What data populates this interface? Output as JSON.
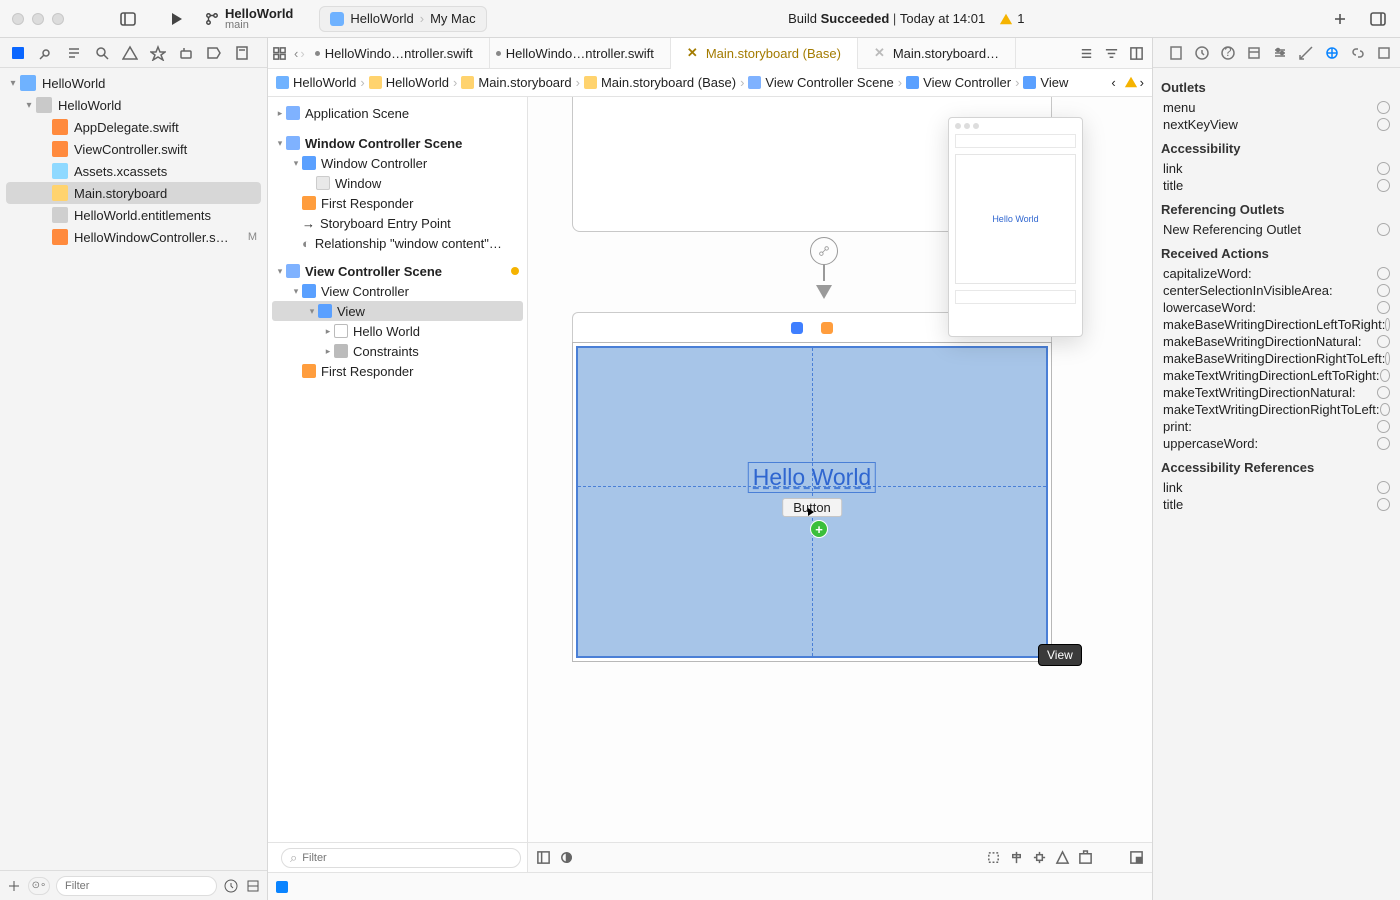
{
  "titlebar": {
    "project_name": "HelloWorld",
    "branch": "main",
    "scheme_app": "HelloWorld",
    "scheme_dest": "My Mac",
    "status_prefix": "Build ",
    "status_result": "Succeeded",
    "status_time": "Today at 14:01",
    "warning_count": "1"
  },
  "nav": {
    "root": "HelloWorld",
    "group": "HelloWorld",
    "files": [
      "AppDelegate.swift",
      "ViewController.swift",
      "Assets.xcassets",
      "Main.storyboard",
      "HelloWorld.entitlements",
      "HelloWindowController.s…"
    ],
    "modified_badge": "M",
    "filter_placeholder": "Filter"
  },
  "tabs": {
    "t1": "HelloWindo…ntroller.swift",
    "t2": "HelloWindo…ntroller.swift",
    "t3": "Main.storyboard (Base)",
    "t4": "Main.storyboard…"
  },
  "jumpbar": {
    "c1": "HelloWorld",
    "c2": "HelloWorld",
    "c3": "Main.storyboard",
    "c4": "Main.storyboard (Base)",
    "c5": "View Controller Scene",
    "c6": "View Controller",
    "c7": "View"
  },
  "outline": {
    "app_scene": "Application Scene",
    "wc_scene": "Window Controller Scene",
    "wc": "Window Controller",
    "window": "Window",
    "first_responder": "First Responder",
    "entry": "Storyboard Entry Point",
    "rel": "Relationship \"window content\"…",
    "vc_scene": "View Controller Scene",
    "vc": "View Controller",
    "view": "View",
    "hello": "Hello World",
    "constraints": "Constraints",
    "filter_placeholder": "Filter"
  },
  "canvas": {
    "hello_label": "Hello World",
    "button_label": "Button",
    "view_badge": "View",
    "lib_label": "Hello World"
  },
  "inspector": {
    "h_outlets": "Outlets",
    "menu": "menu",
    "nextKeyView": "nextKeyView",
    "h_access": "Accessibility",
    "link": "link",
    "title": "title",
    "h_ref": "Referencing Outlets",
    "newref": "New Referencing Outlet",
    "h_recv": "Received Actions",
    "actions": [
      "capitalizeWord:",
      "centerSelectionInVisibleArea:",
      "lowercaseWord:",
      "makeBaseWritingDirectionLeftToRight:",
      "makeBaseWritingDirectionNatural:",
      "makeBaseWritingDirectionRightToLeft:",
      "makeTextWritingDirectionLeftToRight:",
      "makeTextWritingDirectionNatural:",
      "makeTextWritingDirectionRightToLeft:",
      "print:",
      "uppercaseWord:"
    ],
    "h_accref": "Accessibility References",
    "link2": "link",
    "title2": "title"
  },
  "bottom": {
    "dots": "⊙∘"
  }
}
